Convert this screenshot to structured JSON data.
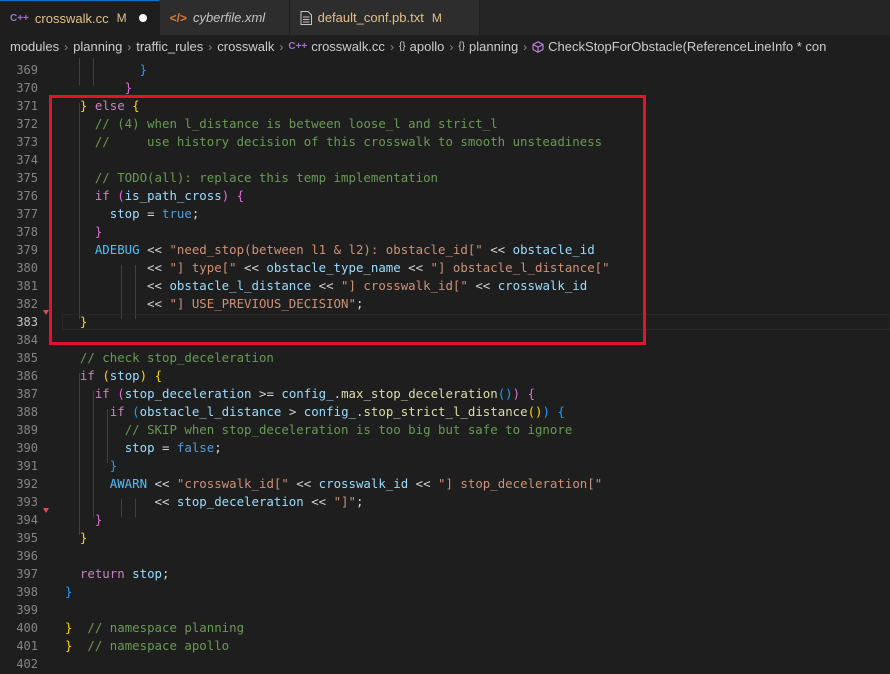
{
  "tabs": [
    {
      "icon": "C++",
      "name": "crosswalk.cc",
      "status": "M",
      "unsaved": true,
      "active": true,
      "style": "mod"
    },
    {
      "icon": "</>",
      "name": "cyberfile.xml",
      "status": "",
      "unsaved": false,
      "active": false,
      "style": "italic"
    },
    {
      "icon": "file",
      "name": "default_conf.pb.txt",
      "status": "M",
      "unsaved": false,
      "active": false,
      "style": "plain"
    }
  ],
  "breadcrumb": {
    "parts": [
      "modules",
      "planning",
      "traffic_rules",
      "crosswalk",
      "crosswalk.cc",
      "apollo",
      "planning",
      "CheckStopForObstacle(ReferenceLineInfo * con"
    ],
    "icons": {
      "file": "C++",
      "namespace": "{}"
    }
  },
  "editor": {
    "current_line": "383",
    "lines": [
      {
        "n": "369",
        "t": [
          [
            "p",
            "          "
          ],
          [
            "b3",
            "}"
          ]
        ]
      },
      {
        "n": "370",
        "t": [
          [
            "p",
            "        "
          ],
          [
            "b2",
            "}"
          ]
        ]
      },
      {
        "n": "371",
        "t": [
          [
            "p",
            "  "
          ],
          [
            "b",
            "}"
          ],
          [
            "p",
            " "
          ],
          [
            "k",
            "else"
          ],
          [
            "p",
            " "
          ],
          [
            "b",
            "{"
          ]
        ]
      },
      {
        "n": "372",
        "t": [
          [
            "p",
            "    "
          ],
          [
            "c",
            "// (4) when l_distance is between loose_l and strict_l"
          ]
        ]
      },
      {
        "n": "373",
        "t": [
          [
            "p",
            "    "
          ],
          [
            "c",
            "//     use history decision of this crosswalk to smooth unsteadiness"
          ]
        ]
      },
      {
        "n": "374",
        "t": [
          [
            "p",
            ""
          ]
        ]
      },
      {
        "n": "375",
        "t": [
          [
            "p",
            "    "
          ],
          [
            "c",
            "// TODO(all): replace this temp implementation"
          ]
        ]
      },
      {
        "n": "376",
        "t": [
          [
            "p",
            "    "
          ],
          [
            "k",
            "if"
          ],
          [
            "p",
            " "
          ],
          [
            "b2",
            "("
          ],
          [
            "v",
            "is_path_cross"
          ],
          [
            "b2",
            ")"
          ],
          [
            "p",
            " "
          ],
          [
            "b2",
            "{"
          ]
        ]
      },
      {
        "n": "377",
        "t": [
          [
            "p",
            "      "
          ],
          [
            "v",
            "stop"
          ],
          [
            "p",
            " = "
          ],
          [
            "kw",
            "true"
          ],
          [
            "p",
            ";"
          ]
        ]
      },
      {
        "n": "378",
        "t": [
          [
            "p",
            "    "
          ],
          [
            "b2",
            "}"
          ]
        ]
      },
      {
        "n": "379",
        "t": [
          [
            "p",
            "    "
          ],
          [
            "m",
            "ADEBUG"
          ],
          [
            "p",
            " << "
          ],
          [
            "s",
            "\"need_stop(between l1 & l2): obstacle_id[\""
          ],
          [
            "p",
            " << "
          ],
          [
            "v",
            "obstacle_id"
          ]
        ]
      },
      {
        "n": "380",
        "t": [
          [
            "p",
            "           << "
          ],
          [
            "s",
            "\"] type[\""
          ],
          [
            "p",
            " << "
          ],
          [
            "v",
            "obstacle_type_name"
          ],
          [
            "p",
            " << "
          ],
          [
            "s",
            "\"] obstacle_l_distance[\""
          ]
        ]
      },
      {
        "n": "381",
        "t": [
          [
            "p",
            "           << "
          ],
          [
            "v",
            "obstacle_l_distance"
          ],
          [
            "p",
            " << "
          ],
          [
            "s",
            "\"] crosswalk_id[\""
          ],
          [
            "p",
            " << "
          ],
          [
            "v",
            "crosswalk_id"
          ]
        ]
      },
      {
        "n": "382",
        "t": [
          [
            "p",
            "           << "
          ],
          [
            "s",
            "\"] USE_PREVIOUS_DECISION\""
          ],
          [
            "p",
            ";"
          ]
        ]
      },
      {
        "n": "383",
        "t": [
          [
            "p",
            "  "
          ],
          [
            "b",
            "}"
          ]
        ]
      },
      {
        "n": "384",
        "t": [
          [
            "p",
            ""
          ]
        ]
      },
      {
        "n": "385",
        "t": [
          [
            "p",
            "  "
          ],
          [
            "c",
            "// check stop_deceleration"
          ]
        ]
      },
      {
        "n": "386",
        "t": [
          [
            "p",
            "  "
          ],
          [
            "k",
            "if"
          ],
          [
            "p",
            " "
          ],
          [
            "b",
            "("
          ],
          [
            "v",
            "stop"
          ],
          [
            "b",
            ")"
          ],
          [
            "p",
            " "
          ],
          [
            "b",
            "{"
          ]
        ]
      },
      {
        "n": "387",
        "t": [
          [
            "p",
            "    "
          ],
          [
            "k",
            "if"
          ],
          [
            "p",
            " "
          ],
          [
            "b2",
            "("
          ],
          [
            "v",
            "stop_deceleration"
          ],
          [
            "p",
            " >= "
          ],
          [
            "v",
            "config_"
          ],
          [
            "p",
            "."
          ],
          [
            "f",
            "max_stop_deceleration"
          ],
          [
            "b3",
            "()"
          ],
          [
            "b2",
            ")"
          ],
          [
            "p",
            " "
          ],
          [
            "b2",
            "{"
          ]
        ]
      },
      {
        "n": "388",
        "t": [
          [
            "p",
            "      "
          ],
          [
            "k",
            "if"
          ],
          [
            "p",
            " "
          ],
          [
            "b3",
            "("
          ],
          [
            "v",
            "obstacle_l_distance"
          ],
          [
            "p",
            " > "
          ],
          [
            "v",
            "config_"
          ],
          [
            "p",
            "."
          ],
          [
            "f",
            "stop_strict_l_distance"
          ],
          [
            "b",
            "()"
          ],
          [
            "b3",
            ")"
          ],
          [
            "p",
            " "
          ],
          [
            "b3",
            "{"
          ]
        ]
      },
      {
        "n": "389",
        "t": [
          [
            "p",
            "        "
          ],
          [
            "c",
            "// SKIP when stop_deceleration is too big but safe to ignore"
          ]
        ]
      },
      {
        "n": "390",
        "t": [
          [
            "p",
            "        "
          ],
          [
            "v",
            "stop"
          ],
          [
            "p",
            " = "
          ],
          [
            "kw",
            "false"
          ],
          [
            "p",
            ";"
          ]
        ]
      },
      {
        "n": "391",
        "t": [
          [
            "p",
            "      "
          ],
          [
            "b3",
            "}"
          ]
        ]
      },
      {
        "n": "392",
        "t": [
          [
            "p",
            "      "
          ],
          [
            "m",
            "AWARN"
          ],
          [
            "p",
            " << "
          ],
          [
            "s",
            "\"crosswalk_id[\""
          ],
          [
            "p",
            " << "
          ],
          [
            "v",
            "crosswalk_id"
          ],
          [
            "p",
            " << "
          ],
          [
            "s",
            "\"] stop_deceleration[\""
          ]
        ]
      },
      {
        "n": "393",
        "t": [
          [
            "p",
            "            << "
          ],
          [
            "v",
            "stop_deceleration"
          ],
          [
            "p",
            " << "
          ],
          [
            "s",
            "\"]\""
          ],
          [
            "p",
            ";"
          ]
        ]
      },
      {
        "n": "394",
        "t": [
          [
            "p",
            "    "
          ],
          [
            "b2",
            "}"
          ]
        ]
      },
      {
        "n": "395",
        "t": [
          [
            "p",
            "  "
          ],
          [
            "b",
            "}"
          ]
        ]
      },
      {
        "n": "396",
        "t": [
          [
            "p",
            ""
          ]
        ]
      },
      {
        "n": "397",
        "t": [
          [
            "p",
            "  "
          ],
          [
            "k",
            "return"
          ],
          [
            "p",
            " "
          ],
          [
            "v",
            "stop"
          ],
          [
            "p",
            ";"
          ]
        ]
      },
      {
        "n": "398",
        "t": [
          [
            "b3",
            "}"
          ]
        ]
      },
      {
        "n": "399",
        "t": [
          [
            "p",
            ""
          ]
        ]
      },
      {
        "n": "400",
        "t": [
          [
            "b",
            "}"
          ],
          [
            "p",
            "  "
          ],
          [
            "c",
            "// namespace planning"
          ]
        ]
      },
      {
        "n": "401",
        "t": [
          [
            "b",
            "}"
          ],
          [
            "p",
            "  "
          ],
          [
            "c",
            "// namespace apollo"
          ]
        ]
      },
      {
        "n": "402",
        "t": [
          [
            "p",
            ""
          ]
        ]
      }
    ]
  },
  "colors": {
    "highlight_box": "#e3132c",
    "modified": "#e2c08d",
    "keyword": "#c586c0",
    "comment": "#6a9955",
    "string": "#ce9178",
    "variable": "#9cdcfe"
  }
}
